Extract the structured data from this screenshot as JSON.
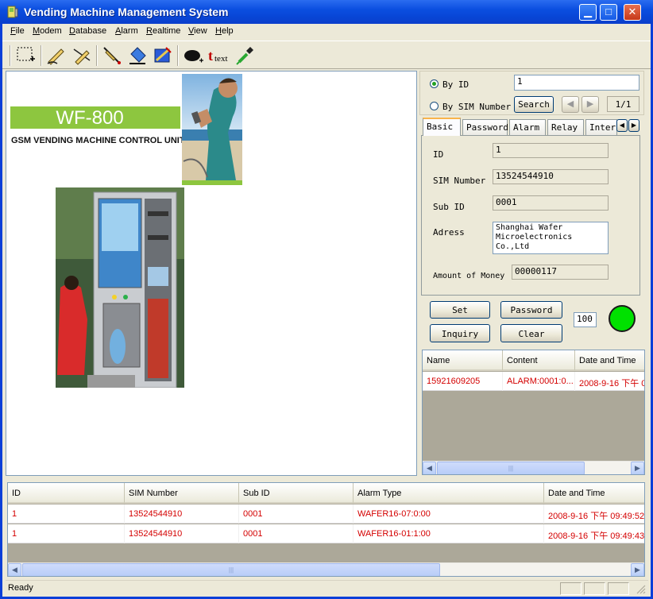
{
  "window": {
    "title": "Vending Machine Management System"
  },
  "menu": [
    {
      "label": "File",
      "hotkey": "F"
    },
    {
      "label": "Modem",
      "hotkey": "M"
    },
    {
      "label": "Database",
      "hotkey": "D"
    },
    {
      "label": "Alarm",
      "hotkey": "A"
    },
    {
      "label": "Realtime",
      "hotkey": "R"
    },
    {
      "label": "View",
      "hotkey": "V"
    },
    {
      "label": "Help",
      "hotkey": "H"
    }
  ],
  "toolbar": {
    "icons": [
      "select-region-icon",
      "pen-icon",
      "erase-line-icon",
      "pencil-icon",
      "paint-bucket-icon",
      "gradient-fill-icon",
      "ellipse-icon",
      "text-tool-icon",
      "eyedropper-icon"
    ],
    "text_tool_label": "text"
  },
  "product": {
    "model": "WF-800",
    "subtitle": "GSM VENDING MACHINE CONTROL UNIT"
  },
  "search": {
    "by_id_label": "By ID",
    "by_sim_label": "By SIM Number",
    "search_value": "1",
    "search_button": "Search",
    "page_indicator": "1/1"
  },
  "tabs": [
    "Basic",
    "Password",
    "Alarm",
    "Relay",
    "Inter:"
  ],
  "basic": {
    "id_label": "ID",
    "id_value": "1",
    "sim_label": "SIM Number",
    "sim_value": "13524544910",
    "subid_label": "Sub ID",
    "subid_value": "0001",
    "address_label": "Adress",
    "address_line1": "Shanghai Wafer",
    "address_line2": "Microelectronics",
    "address_line3": "Co.,Ltd",
    "money_label": "Amount of Money",
    "money_value": "00000117"
  },
  "actions": {
    "set": "Set",
    "password": "Password",
    "inquiry": "Inquiry",
    "clear": "Clear",
    "interval_value": "100",
    "status_color": "#00e100"
  },
  "messages": {
    "columns": [
      "Name",
      "Content",
      "Date and Time"
    ],
    "rows": [
      [
        "15921609205",
        "ALARM:0001:0...",
        "2008-9-16 下午 0"
      ]
    ]
  },
  "alarms": {
    "columns": [
      "ID",
      "SIM Number",
      "Sub ID",
      "Alarm Type",
      "Date and Time"
    ],
    "rows": [
      [
        "1",
        "13524544910",
        "0001",
        "WAFER16-07:0:00",
        "2008-9-16 下午 09:49:52"
      ],
      [
        "1",
        "13524544910",
        "0001",
        "WAFER16-01:1:00",
        "2008-9-16 下午 09:49:43"
      ]
    ]
  },
  "status": {
    "text": "Ready"
  },
  "colors": {
    "alarm_text": "#d40000",
    "title_bar": "#0b4ee0",
    "brand_green": "#8dc63f"
  }
}
